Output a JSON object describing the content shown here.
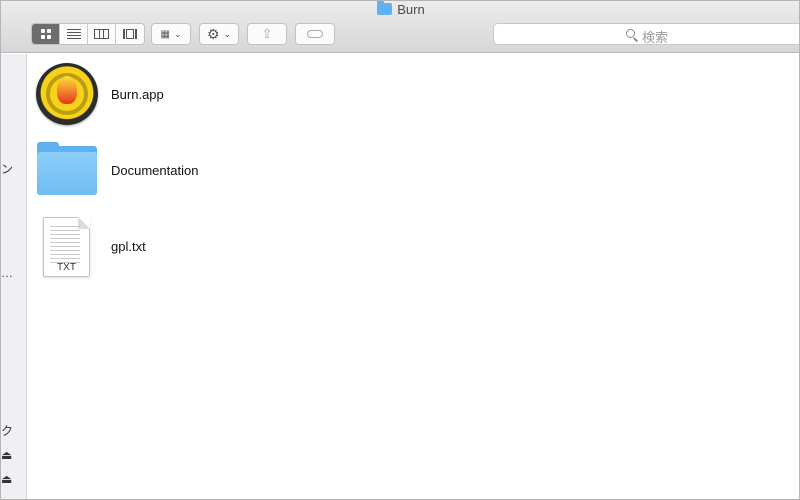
{
  "window": {
    "title": "Burn"
  },
  "toolbar": {
    "view_modes": [
      {
        "name": "icon-view",
        "active": true
      },
      {
        "name": "list-view",
        "active": false
      },
      {
        "name": "column-view",
        "active": false
      },
      {
        "name": "coverflow-view",
        "active": false
      }
    ],
    "search_placeholder": "検索"
  },
  "sidebar": {
    "fragments": [
      "ン",
      "…",
      "ク",
      "⏏",
      "⏏"
    ]
  },
  "files": [
    {
      "name": "Burn.app",
      "kind": "app-icon"
    },
    {
      "name": "Documentation",
      "kind": "folder-icon"
    },
    {
      "name": "gpl.txt",
      "kind": "text-file-icon",
      "ext": "TXT"
    }
  ]
}
